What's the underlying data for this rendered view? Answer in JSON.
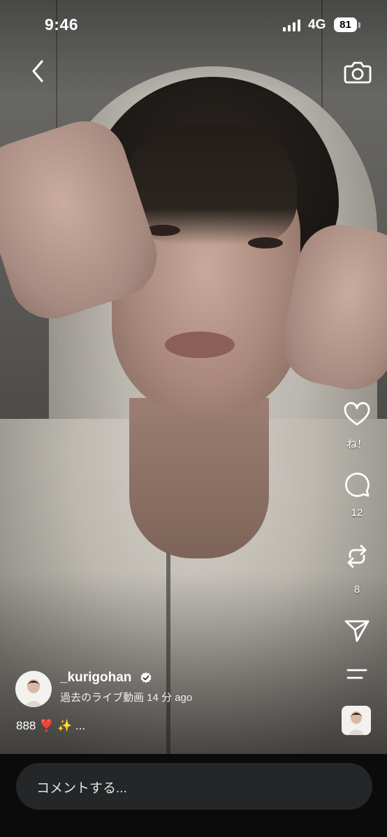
{
  "status_bar": {
    "time": "9:46",
    "network": "4G",
    "battery": "81"
  },
  "icons": {
    "back": "chevron-left-icon",
    "camera": "camera-icon",
    "like": "heart-icon",
    "comment": "speech-bubble-icon",
    "repost": "repost-arrows-icon",
    "share": "paper-plane-icon",
    "more": "menu-lines-icon",
    "verified": "verified-badge-icon"
  },
  "actions": {
    "like_label": "ね！",
    "comment_count": "12",
    "repost_count": "8"
  },
  "post": {
    "username": "_kurigohan",
    "subtitle": "過去のライブ動画 14 分 ago",
    "caption": "888 ❣️ ✨ ..."
  },
  "comment_input": {
    "placeholder": "コメントする..."
  },
  "colors": {
    "accent": "#ffffff",
    "bottom_bar": "#0b0b0c",
    "input_bg": "#242628"
  }
}
